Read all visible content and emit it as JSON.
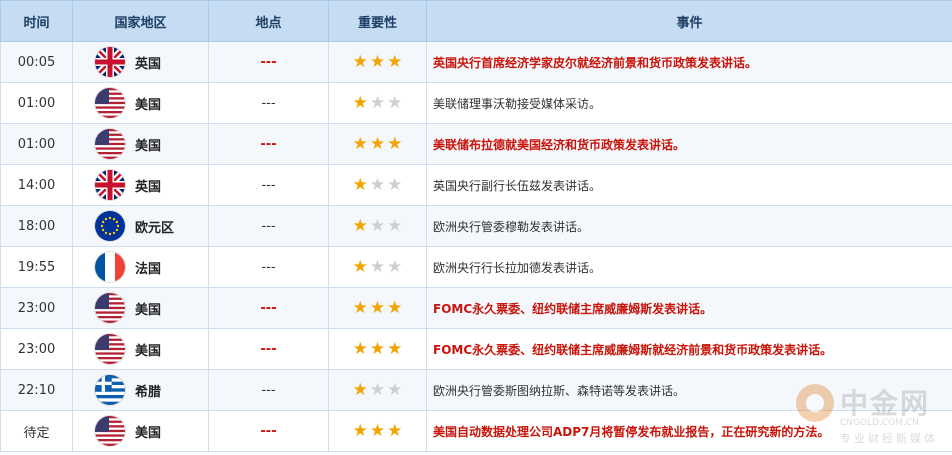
{
  "headers": {
    "time": "时间",
    "country": "国家地区",
    "location": "地点",
    "importance": "重要性",
    "event": "事件"
  },
  "colors": {
    "highlight": "#c8140a",
    "header_bg": "#c5dcf2",
    "star_on": "#f2a400",
    "star_off": "#cfcfcf"
  },
  "rows": [
    {
      "time": "00:05",
      "flag": "uk-flag-icon",
      "country": "英国",
      "location": "---",
      "stars": 3,
      "event": "英国央行首席经济学家皮尔就经济前景和货币政策发表讲话。"
    },
    {
      "time": "01:00",
      "flag": "us-flag-icon",
      "country": "美国",
      "location": "---",
      "stars": 1,
      "event": "美联储理事沃勒接受媒体采访。"
    },
    {
      "time": "01:00",
      "flag": "us-flag-icon",
      "country": "美国",
      "location": "---",
      "stars": 3,
      "event": "美联储布拉德就美国经济和货币政策发表讲话。"
    },
    {
      "time": "14:00",
      "flag": "uk-flag-icon",
      "country": "英国",
      "location": "---",
      "stars": 1,
      "event": "英国央行副行长伍兹发表讲话。"
    },
    {
      "time": "18:00",
      "flag": "eu-flag-icon",
      "country": "欧元区",
      "location": "---",
      "stars": 1,
      "event": "欧洲央行管委穆勒发表讲话。"
    },
    {
      "time": "19:55",
      "flag": "fr-flag-icon",
      "country": "法国",
      "location": "---",
      "stars": 1,
      "event": "欧洲央行行长拉加德发表讲话。"
    },
    {
      "time": "23:00",
      "flag": "us-flag-icon",
      "country": "美国",
      "location": "---",
      "stars": 3,
      "event": "FOMC永久票委、纽约联储主席威廉姆斯发表讲话。"
    },
    {
      "time": "23:00",
      "flag": "us-flag-icon",
      "country": "美国",
      "location": "---",
      "stars": 3,
      "event": "FOMC永久票委、纽约联储主席威廉姆斯就经济前景和货币政策发表讲话。"
    },
    {
      "time": "22:10",
      "flag": "gr-flag-icon",
      "country": "希腊",
      "location": "---",
      "stars": 1,
      "event": "欧洲央行管委斯图纳拉斯、森特诺等发表讲话。"
    },
    {
      "time": "待定",
      "flag": "us-flag-icon",
      "country": "美国",
      "location": "---",
      "stars": 3,
      "event": "美国自动数据处理公司ADP7月将暂停发布就业报告，正在研究新的方法。"
    }
  ],
  "watermark": {
    "cn": "中金网",
    "url": "CNGOLD.COM.CN",
    "slogan": "专业财经新媒体"
  }
}
